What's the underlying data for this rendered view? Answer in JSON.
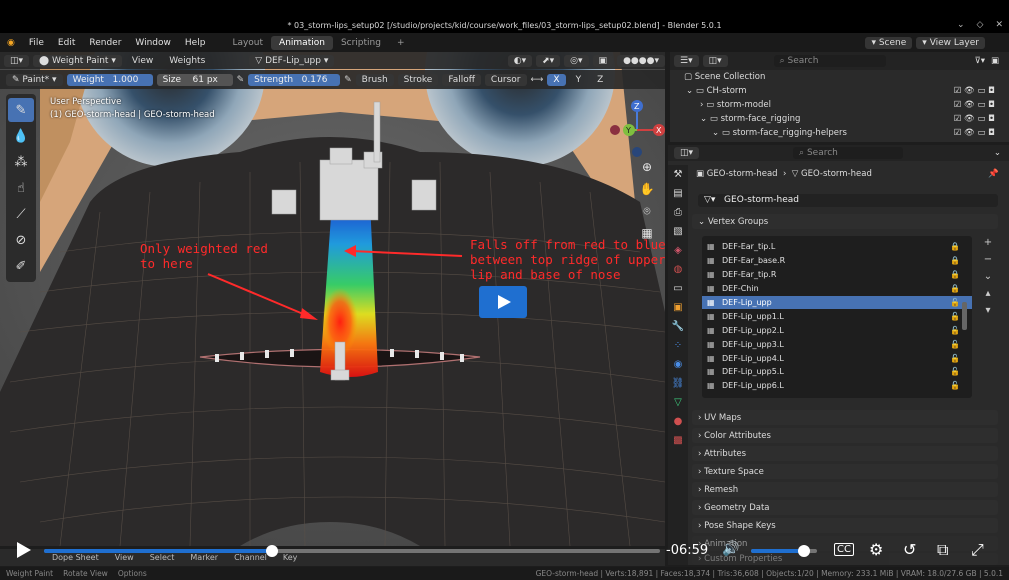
{
  "window": {
    "title": "* 03_storm-lips_setup02 [/studio/projects/kid/course/work_files/03_storm-lips_setup02.blend] - Blender 5.0.1"
  },
  "menu": {
    "items": [
      "File",
      "Edit",
      "Render",
      "Window",
      "Help"
    ],
    "workspaces": [
      "Layout",
      "Animation",
      "Scripting"
    ],
    "add": "+"
  },
  "viewport_header": {
    "mode": "Weight Paint",
    "view": "View",
    "weights": "Weights",
    "vgroup": "DEF-Lip_upp"
  },
  "tool_settings": {
    "brush": "Paint*",
    "weight_label": "Weight",
    "weight_value": "1.000",
    "size_label": "Size",
    "size_value": "61 px",
    "strength_label": "Strength",
    "strength_value": "0.176",
    "brush_menu": "Brush",
    "stroke_menu": "Stroke",
    "falloff_menu": "Falloff",
    "cursor_menu": "Cursor",
    "axes": [
      "X",
      "Y",
      "Z"
    ]
  },
  "viewport_info": {
    "line1": "User Perspective",
    "line2": "(1) GEO-storm-head | GEO-storm-head"
  },
  "annotations": {
    "left": "Only weighted red\nto here",
    "right": "Falls off from red to blue\nbetween top ridge of upper\nlip and base of nose"
  },
  "gizmo": {
    "z": "Z",
    "y": "Y",
    "x": "X"
  },
  "top_right": {
    "scene": "Scene",
    "view_layer": "View Layer"
  },
  "outliner": {
    "search_placeholder": "Search",
    "items": [
      {
        "label": "Scene Collection"
      },
      {
        "label": "CH-storm"
      },
      {
        "label": "storm-model"
      },
      {
        "label": "storm-face_rigging"
      },
      {
        "label": "storm-face_rigging-helpers"
      }
    ]
  },
  "properties": {
    "search_placeholder": "Search",
    "breadcrumb_object": "GEO-storm-head",
    "breadcrumb_mesh": "GEO-storm-head",
    "mesh_name": "GEO-storm-head",
    "vertex_groups_title": "Vertex Groups",
    "vertex_groups": [
      {
        "name": "DEF-Ear_tip.L",
        "locked": true
      },
      {
        "name": "DEF-Ear_base.R",
        "locked": true
      },
      {
        "name": "DEF-Ear_tip.R",
        "locked": true
      },
      {
        "name": "DEF-Chin",
        "locked": true
      },
      {
        "name": "DEF-Lip_upp",
        "locked": false,
        "selected": true
      },
      {
        "name": "DEF-Lip_upp1.L",
        "locked": false
      },
      {
        "name": "DEF-Lip_upp2.L",
        "locked": false
      },
      {
        "name": "DEF-Lip_upp3.L",
        "locked": false
      },
      {
        "name": "DEF-Lip_upp4.L",
        "locked": false
      },
      {
        "name": "DEF-Lip_upp5.L",
        "locked": false
      },
      {
        "name": "DEF-Lip_upp6.L",
        "locked": false
      }
    ],
    "panels": [
      "UV Maps",
      "Color Attributes",
      "Attributes",
      "Texture Space",
      "Remesh",
      "Geometry Data",
      "Pose Shape Keys",
      "Animation",
      "Custom Properties"
    ]
  },
  "video": {
    "time": "-06:59",
    "progress": 0.37,
    "volume": 0.8
  },
  "dopesheet": {
    "title": "Dope Sheet",
    "menus": [
      "View",
      "Select",
      "Marker",
      "Channel",
      "Key"
    ]
  },
  "statusbar": {
    "left": [
      "Weight Paint",
      "Rotate View",
      "Options"
    ],
    "right": "GEO-storm-head | Verts:18,891 | Faces:18,374 | Tris:36,608 | Objects:1/20 | Memory: 233.1 MiB | VRAM: 18.0/27.6 GB | 5.0.1"
  }
}
